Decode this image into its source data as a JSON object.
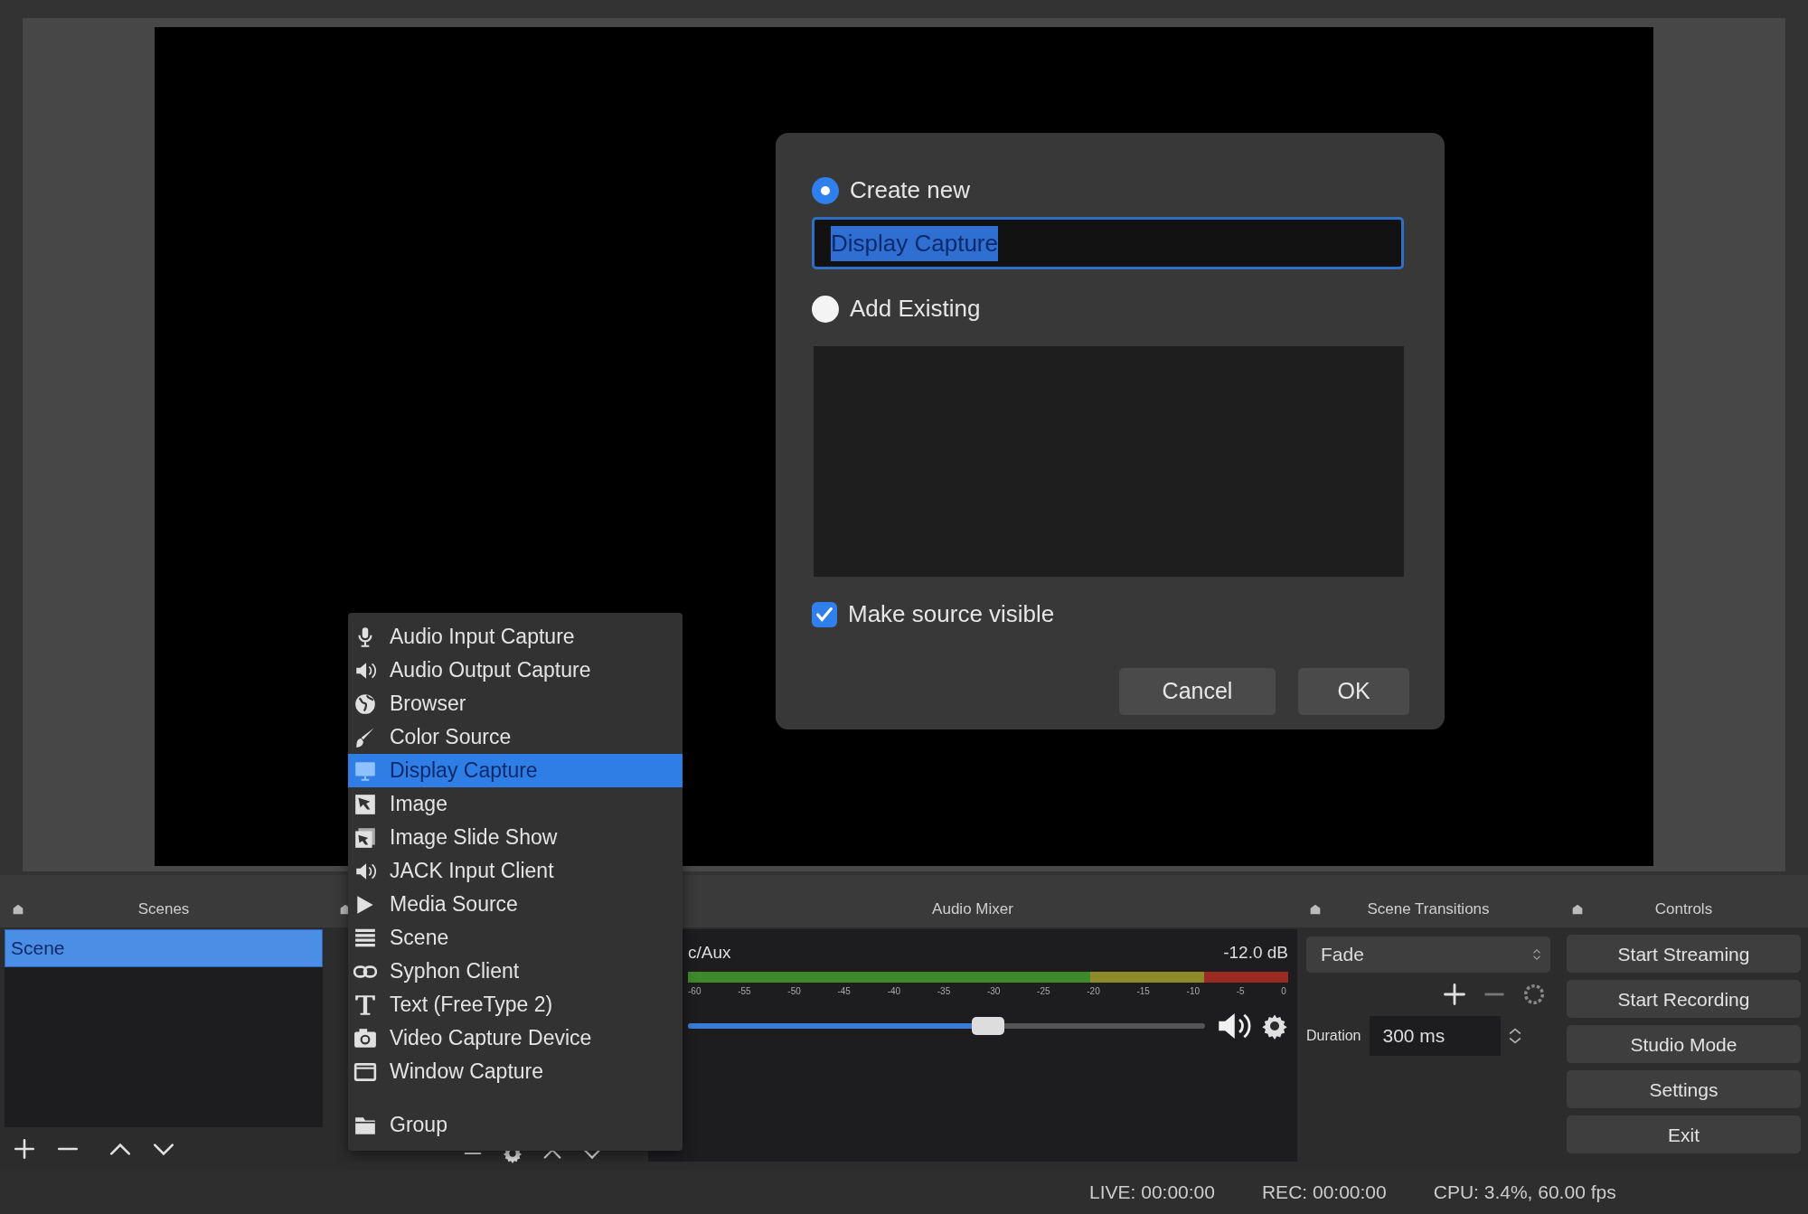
{
  "dialog": {
    "options": [
      {
        "label": "Create new",
        "selected": true
      },
      {
        "label": "Add Existing",
        "selected": false
      }
    ],
    "name_field": {
      "value": "Display Capture",
      "text_selected": true
    },
    "make_visible": {
      "label": "Make source visible",
      "checked": true
    },
    "buttons": [
      "Cancel",
      "OK"
    ]
  },
  "add_source_menu": {
    "items": [
      {
        "label": "Audio Input Capture",
        "selected": false
      },
      {
        "label": "Audio Output Capture",
        "selected": false
      },
      {
        "label": "Browser",
        "selected": false
      },
      {
        "label": "Color Source",
        "selected": false
      },
      {
        "label": "Display Capture",
        "selected": true
      },
      {
        "label": "Image",
        "selected": false
      },
      {
        "label": "Image Slide Show",
        "selected": false
      },
      {
        "label": "JACK Input Client",
        "selected": false
      },
      {
        "label": "Media Source",
        "selected": false
      },
      {
        "label": "Scene",
        "selected": false
      },
      {
        "label": "Syphon Client",
        "selected": false
      },
      {
        "label": "Text (FreeType 2)",
        "selected": false
      },
      {
        "label": "Video Capture Device",
        "selected": false
      },
      {
        "label": "Window Capture",
        "selected": false
      }
    ],
    "extra_items": [
      {
        "label": "Group",
        "selected": false
      }
    ]
  },
  "scenes": {
    "title": "Scenes",
    "items": [
      {
        "label": "Scene",
        "selected": true
      }
    ]
  },
  "audio_mixer": {
    "title": "Audio Mixer",
    "channels": [
      {
        "name": "c/Aux",
        "reading": "-12.0 dB",
        "level": 0.58,
        "ticks": [
          "-60",
          "-55",
          "-50",
          "-45",
          "-40",
          "-35",
          "-30",
          "-25",
          "-20",
          "-15",
          "-10",
          "-5",
          "0"
        ]
      }
    ]
  },
  "scene_transitions": {
    "title": "Scene Transitions",
    "transition": "Fade",
    "duration_label": "Duration",
    "duration": "300 ms"
  },
  "controls": {
    "title": "Controls",
    "buttons": [
      "Start Streaming",
      "Start Recording",
      "Studio Mode",
      "Settings",
      "Exit"
    ]
  },
  "status_bar": [
    "LIVE: 00:00:00",
    "REC: 00:00:00",
    "CPU: 3.4%, 60.00 fps"
  ]
}
